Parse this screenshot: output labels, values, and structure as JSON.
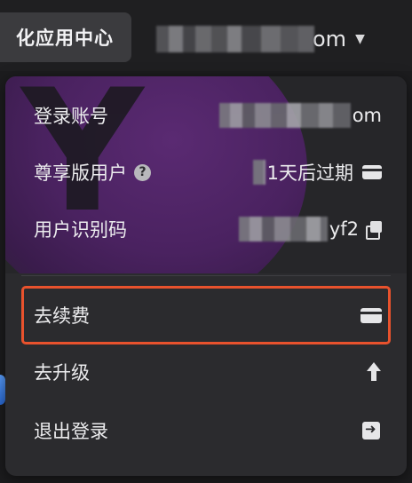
{
  "topbar": {
    "button_label": "化应用中心",
    "user_account_tail": "om",
    "caret": "▼"
  },
  "account_panel": {
    "login_account": {
      "label": "登录账号",
      "value_tail": "om"
    },
    "membership": {
      "label": "尊享版用户",
      "help": "?",
      "value": "1天后过期"
    },
    "user_code": {
      "label": "用户识别码",
      "value_tail": "yf2"
    }
  },
  "menu": {
    "renew": "去续费",
    "upgrade": "去升级",
    "logout": "退出登录"
  },
  "colors": {
    "highlight_border": "#e8522d",
    "banner_purple": "#4a2260"
  }
}
